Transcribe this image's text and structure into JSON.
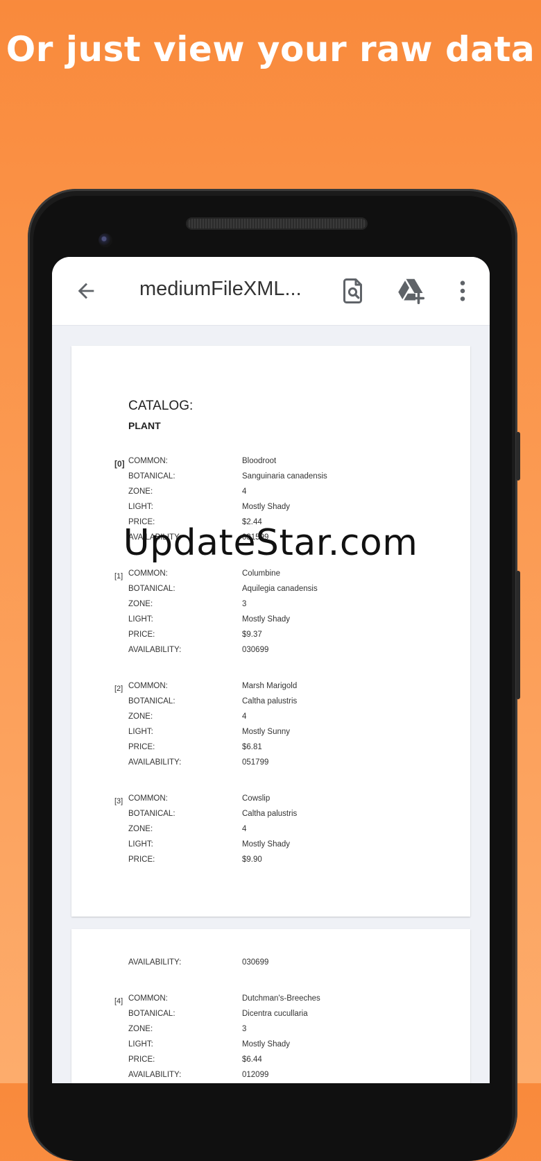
{
  "headline": "Or just view your raw data",
  "watermark": "UpdateStar.com",
  "appbar": {
    "title": "mediumFileXML...",
    "back_icon": "arrow-left-icon",
    "preview_icon": "document-search-icon",
    "drive_icon": "google-drive-add-icon",
    "more_icon": "more-vert-icon"
  },
  "colors": {
    "background_top": "#f98a3c",
    "background_bottom": "#fdac6c",
    "phone_body": "#1b1b1b",
    "screen_bg": "#eff1f6",
    "page_bg": "#ffffff"
  },
  "document": {
    "catalog_heading": "CATALOG:",
    "plant_heading": "PLANT",
    "page1_records": [
      {
        "index": "[0]",
        "fields": [
          {
            "key": "COMMON:",
            "value": "Bloodroot"
          },
          {
            "key": "BOTANICAL:",
            "value": "Sanguinaria canadensis"
          },
          {
            "key": "ZONE:",
            "value": "4"
          },
          {
            "key": "LIGHT:",
            "value": "Mostly Shady"
          },
          {
            "key": "PRICE:",
            "value": "$2.44"
          },
          {
            "key": "AVAILABILITY:",
            "value": "031599"
          }
        ]
      },
      {
        "index": "[1]",
        "fields": [
          {
            "key": "COMMON:",
            "value": "Columbine"
          },
          {
            "key": "BOTANICAL:",
            "value": "Aquilegia canadensis"
          },
          {
            "key": "ZONE:",
            "value": "3"
          },
          {
            "key": "LIGHT:",
            "value": "Mostly Shady"
          },
          {
            "key": "PRICE:",
            "value": "$9.37"
          },
          {
            "key": "AVAILABILITY:",
            "value": "030699"
          }
        ]
      },
      {
        "index": "[2]",
        "fields": [
          {
            "key": "COMMON:",
            "value": "Marsh Marigold"
          },
          {
            "key": "BOTANICAL:",
            "value": "Caltha palustris"
          },
          {
            "key": "ZONE:",
            "value": "4"
          },
          {
            "key": "LIGHT:",
            "value": "Mostly Sunny"
          },
          {
            "key": "PRICE:",
            "value": "$6.81"
          },
          {
            "key": "AVAILABILITY:",
            "value": "051799"
          }
        ]
      },
      {
        "index": "[3]",
        "fields": [
          {
            "key": "COMMON:",
            "value": "Cowslip"
          },
          {
            "key": "BOTANICAL:",
            "value": "Caltha palustris"
          },
          {
            "key": "ZONE:",
            "value": "4"
          },
          {
            "key": "LIGHT:",
            "value": "Mostly Shady"
          },
          {
            "key": "PRICE:",
            "value": "$9.90"
          }
        ]
      }
    ],
    "page2_carry": {
      "key": "AVAILABILITY:",
      "value": "030699"
    },
    "page2_records": [
      {
        "index": "[4]",
        "fields": [
          {
            "key": "COMMON:",
            "value": "Dutchman's-Breeches"
          },
          {
            "key": "BOTANICAL:",
            "value": "Dicentra cucullaria"
          },
          {
            "key": "ZONE:",
            "value": "3"
          },
          {
            "key": "LIGHT:",
            "value": "Mostly Shady"
          },
          {
            "key": "PRICE:",
            "value": "$6.44"
          },
          {
            "key": "AVAILABILITY:",
            "value": "012099"
          }
        ]
      }
    ]
  }
}
